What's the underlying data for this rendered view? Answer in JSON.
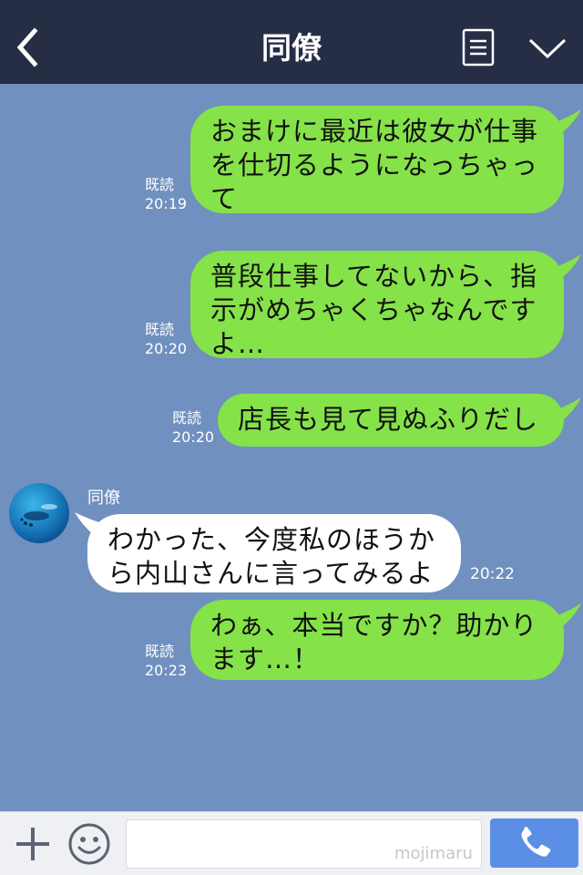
{
  "header": {
    "title": "同僚"
  },
  "messages": [
    {
      "side": "out",
      "text": "おまけに最近は彼女が仕事を仕切るようになっちゃって",
      "read": "既読",
      "time": "20:19"
    },
    {
      "side": "out",
      "text": "普段仕事してないから、指示がめちゃくちゃなんですよ…",
      "read": "既読",
      "time": "20:20"
    },
    {
      "side": "out",
      "text": "店長も見て見ぬふりだし",
      "read": "既読",
      "time": "20:20"
    },
    {
      "side": "in",
      "sender": "同僚",
      "text": "わかった、今度私のほうから内山さんに言ってみるよ",
      "time": "20:22"
    },
    {
      "side": "out",
      "text": "わぁ、本当ですか？助かります…！",
      "read": "既読",
      "time": "20:23"
    }
  ],
  "footer": {
    "input_placeholder": "",
    "watermark": "mojimaru"
  },
  "colors": {
    "header_bg": "#262e45",
    "chat_bg": "#7090bf",
    "outgoing_bubble": "#85e249",
    "incoming_bubble": "#ffffff",
    "call_button": "#5b8fe6"
  },
  "icons": [
    "back-chevron-icon",
    "menu-list-icon",
    "chevron-down-icon",
    "plus-icon",
    "emoji-icon",
    "phone-icon"
  ]
}
